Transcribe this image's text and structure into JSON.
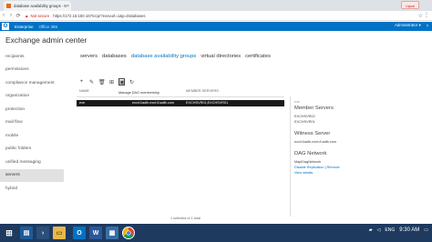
{
  "browser": {
    "tab_title": "database availability groups - M",
    "tab_close": "×",
    "user_chip": "Ugsai",
    "back_icon": "‹",
    "forward_icon": "›",
    "reload_icon": "⟳",
    "not_secure": "Not secure",
    "url": "https://172.16.150.167/ecp/?exsvurl=1&p=Databases",
    "star_icon": "☆",
    "menu_icon": "⋮"
  },
  "o365": {
    "enterprise": "Enterprise",
    "office365": "Office 365",
    "admin": "Administrator ▾",
    "help": "?"
  },
  "app": {
    "title": "Exchange admin center"
  },
  "sidebar": {
    "items": [
      {
        "label": "recipients"
      },
      {
        "label": "permissions"
      },
      {
        "label": "compliance management"
      },
      {
        "label": "organization"
      },
      {
        "label": "protection"
      },
      {
        "label": "mail flow"
      },
      {
        "label": "mobile"
      },
      {
        "label": "public folders"
      },
      {
        "label": "unified messaging"
      },
      {
        "label": "servers"
      },
      {
        "label": "hybrid"
      }
    ],
    "active_index": 9
  },
  "topnav": {
    "tabs": [
      "servers",
      "databases",
      "database availability groups",
      "virtual directories",
      "certificates"
    ],
    "active_index": 2
  },
  "toolbar": {
    "add": "+",
    "edit": "✎",
    "delete": "🗑",
    "network": "⊞",
    "manage": "▣",
    "refresh": "↻"
  },
  "grid": {
    "headers": {
      "name": "NAME",
      "members": "MEMBER SERVERS"
    },
    "tooltip": "Manage DAG membership",
    "row": {
      "name": "exe",
      "witness": "exch1\\adlb.exch1\\adlb.com",
      "members": "EXCHSVR01;EXCHSVR01"
    },
    "footer": "1 selected of 1 total"
  },
  "details": {
    "dag_name": "exe",
    "member_servers_heading": "Member Servers",
    "members": [
      "EXCHSVR02",
      "EXCHSVR01"
    ],
    "witness_heading": "Witness Server",
    "witness": "exch1\\adlb.exch1\\adlb.com",
    "network_heading": "DAG Network",
    "network_name": "MapiDagNetwork",
    "disable_replication": "Disable Replication",
    "separator": "|",
    "remove": "Remove",
    "view_details": "View details"
  },
  "taskbar": {
    "lang": "ENG",
    "time": "9:30 AM"
  },
  "colors": {
    "o365_blue": "#0072c6",
    "taskbar": "#1e3a5f",
    "selected_row": "#1a1a1a"
  }
}
